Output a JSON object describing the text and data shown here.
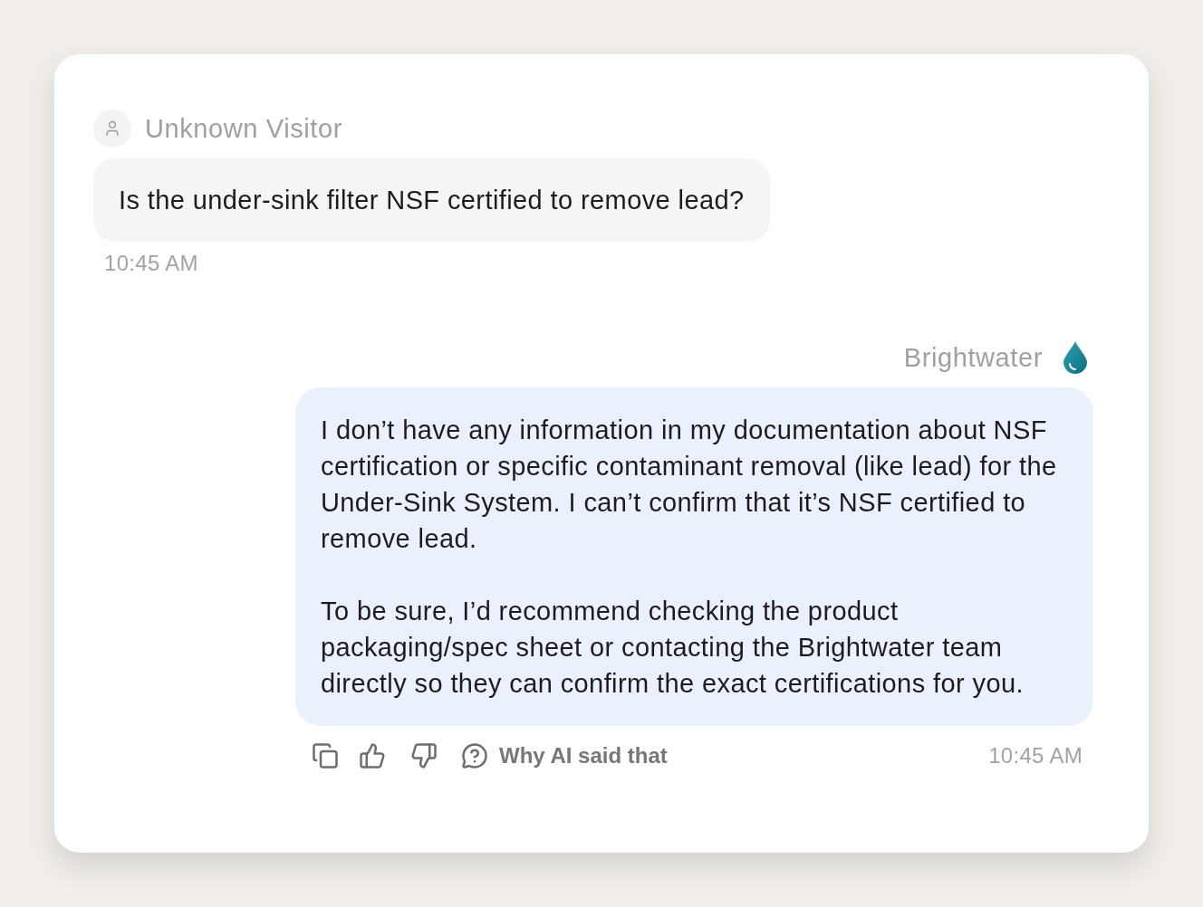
{
  "visitor": {
    "name": "Unknown Visitor",
    "message": "Is the under-sink filter NSF certified to remove lead?",
    "time": "10:45 AM"
  },
  "reply": {
    "sender": "Brightwater",
    "paragraphs": [
      "I don’t have any information in my documentation about NSF certification or specific contaminant removal (like lead) for the Under-Sink System. I can’t confirm that it’s NSF certified to remove lead.",
      "To be sure, I’d recommend checking the product packaging/spec sheet or contacting the Brightwater team directly so they can confirm the exact certifications for you."
    ],
    "why_label": "Why AI said that",
    "time": "10:45 AM"
  }
}
